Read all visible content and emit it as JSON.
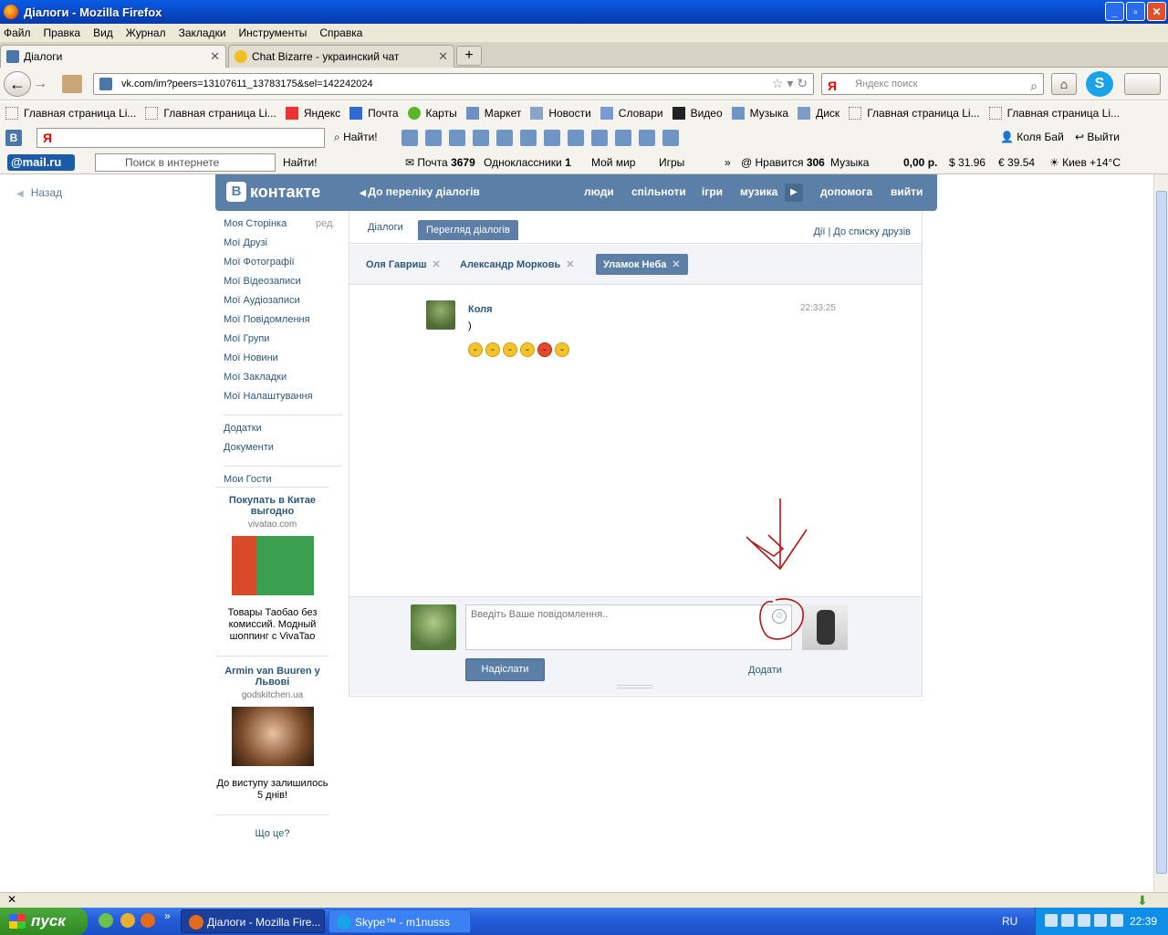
{
  "window": {
    "title": "Діалоги - Mozilla Firefox",
    "controls": [
      "_",
      "▫",
      "✕"
    ]
  },
  "menu": [
    "Файл",
    "Правка",
    "Вид",
    "Журнал",
    "Закладки",
    "Инструменты",
    "Справка"
  ],
  "tabs": [
    {
      "label": "Діалоги",
      "active": true
    },
    {
      "label": "Chat Bizarre - украинский чат",
      "active": false
    }
  ],
  "nav": {
    "url": "vk.com/im?peers=13107611_13783175&sel=142242024",
    "search_placeholder": "Яндекс поиск",
    "search_engine_glyph": "Я"
  },
  "bookmarks": [
    "Главная страница Li...",
    "Главная страница Li...",
    "Яндекс",
    "Почта",
    "Карты",
    "Маркет",
    "Новости",
    "Словари",
    "Видео",
    "Музыка",
    "Диск",
    "Главная страница Li...",
    "Главная страница Li..."
  ],
  "yandex_bar": {
    "vk_glyph": "B",
    "input_glyph": "Я",
    "find_label": "Найти!",
    "user": "Коля Бай",
    "logout": "Выйти"
  },
  "mail_bar": {
    "logo": "@mail.ru",
    "search_placeholder": "Поиск в интернете",
    "find_label": "Найти!",
    "mail_label": "Почта",
    "mail_count": "3679",
    "ok_label": "Одноклассники",
    "ok_count": "1",
    "myworld": "Мой мир",
    "games": "Игры",
    "more": "»",
    "likes_label": "Нравится",
    "likes_count": "306",
    "music": "Музыка",
    "balance": "0,00 р.",
    "usd": "31.96",
    "eur": "39.54",
    "weather": "Киев +14°C"
  },
  "page": {
    "back": "Назад",
    "vk_logo_glyph": "B",
    "vk_logo": "контакте",
    "to_list": "До переліку діалогів",
    "header_nav": [
      "люди",
      "спільноти",
      "ігри",
      "музика",
      "допомога",
      "вийти"
    ],
    "left_menu": [
      "Моя Сторінка",
      "Мої Друзі",
      "Мої Фотографії",
      "Мої Відеозаписи",
      "Мої Аудіозаписи",
      "Мої Повідомлення",
      "Мої Групи",
      "Мої Новини",
      "Мої Закладки",
      "Мої Налаштування"
    ],
    "edit_label": "ред.",
    "left_extra": [
      "Додатки",
      "Документи"
    ],
    "guests": "Мои Гости",
    "ads": [
      {
        "title": "Покупать в Китае выгодно",
        "domain": "vivatao.com",
        "text": "Товары Таобао без комиссий. Модный шоппинг с VivaTao"
      },
      {
        "title": "Armin van Buuren у Львові",
        "domain": "godskitchen.ua",
        "text": "До виступу залишилось 5 днів!"
      }
    ],
    "what_is": "Що це?",
    "dialog_tabs": [
      "Діалоги",
      "Перегляд діалогів"
    ],
    "actions_label": "Дії",
    "to_friends": "До списку друзів",
    "peers": [
      "Оля Гавриш",
      "Александр Морковь",
      "Уламок Неба"
    ],
    "peer_close": "✕",
    "message": {
      "author": "Коля",
      "text": ")",
      "time": "22:33:25",
      "emoji_count": 6
    },
    "compose": {
      "placeholder": "Введіть Ваше повідомлення..",
      "send": "Надіслати",
      "add": "Додати"
    }
  },
  "taskbar": {
    "start": "пуск",
    "more": "»",
    "items": [
      {
        "label": "Діалоги - Mozilla Fire...",
        "active": true
      },
      {
        "label": "Skype™ - m1nusss",
        "active": false
      }
    ],
    "lang": "RU",
    "clock": "22:39"
  },
  "colors": {
    "vk_blue": "#5b7fa6",
    "vk_link": "#2b587a",
    "annotation": "#b01818",
    "xp_blue": "#245edb"
  }
}
